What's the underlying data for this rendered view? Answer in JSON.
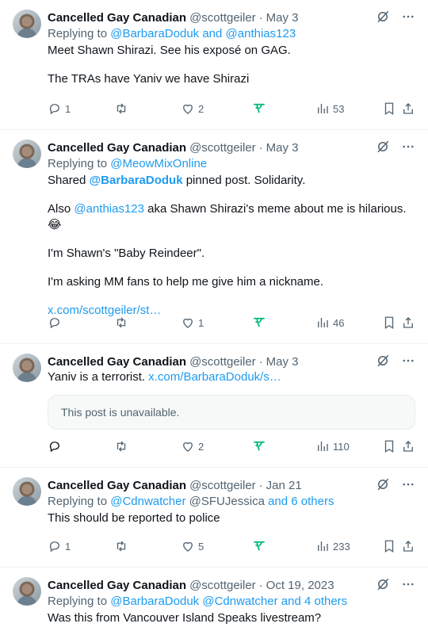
{
  "tweets": [
    {
      "name": "Cancelled Gay Canadian",
      "handle": "@scottgeiler",
      "date": "May 3",
      "replying_prefix": "Replying to ",
      "replying_user1": "@BarbaraDoduk",
      "replying_and": " and ",
      "replying_user2": "@anthias123",
      "line1": "Meet Shawn Shirazi. See his exposé on GAG.",
      "line2": "The TRAs have Yaniv we have Shirazi",
      "replies": "1",
      "retweets": "",
      "likes": "2",
      "views": "53"
    },
    {
      "name": "Cancelled Gay Canadian",
      "handle": "@scottgeiler",
      "date": "May 3",
      "replying_prefix": "Replying to ",
      "replying_user1": "@MeowMixOnline",
      "shared_prefix": "Shared ",
      "shared_mention": "@BarbaraDoduk",
      "shared_suffix": " pinned post. Solidarity.",
      "also_prefix": "Also ",
      "also_mention": "@anthias123",
      "also_suffix": " aka Shawn Shirazi's meme about me is hilarious. 😂",
      "line3": "I'm Shawn's \"Baby Reindeer\".",
      "line4": "I'm asking MM fans to help me give him a nickname.",
      "link": "x.com/scottgeiler/st…",
      "replies": "",
      "retweets": "",
      "likes": "1",
      "views": "46"
    },
    {
      "name": "Cancelled Gay Canadian",
      "handle": "@scottgeiler",
      "date": "May 3",
      "text_prefix": "Yaniv is a terrorist. ",
      "link": "x.com/BarbaraDoduk/s…",
      "unavailable": "This post is unavailable.",
      "replies": "",
      "retweets": "",
      "likes": "2",
      "views": "110"
    },
    {
      "name": "Cancelled Gay Canadian",
      "handle": "@scottgeiler",
      "date": "Jan 21",
      "replying_prefix": "Replying to ",
      "replying_user1": "@Cdnwatcher",
      "replying_user2": " @SFUJessica",
      "replying_others": " and 6 others",
      "line1": "This should be reported to police",
      "replies": "1",
      "retweets": "",
      "likes": "5",
      "views": "233"
    },
    {
      "name": "Cancelled Gay Canadian",
      "handle": "@scottgeiler",
      "date": "Oct 19, 2023",
      "replying_prefix": "Replying to ",
      "replying_user1": "@BarbaraDoduk",
      "replying_user2": " @Cdnwatcher",
      "replying_others": " and 4 others",
      "line1": "Was this from Vancouver Island Speaks livestream?"
    }
  ],
  "dot": "·",
  "colors": {
    "link": "#1d9bf0",
    "muted": "#536471",
    "grok_green": "#00ba7c"
  }
}
